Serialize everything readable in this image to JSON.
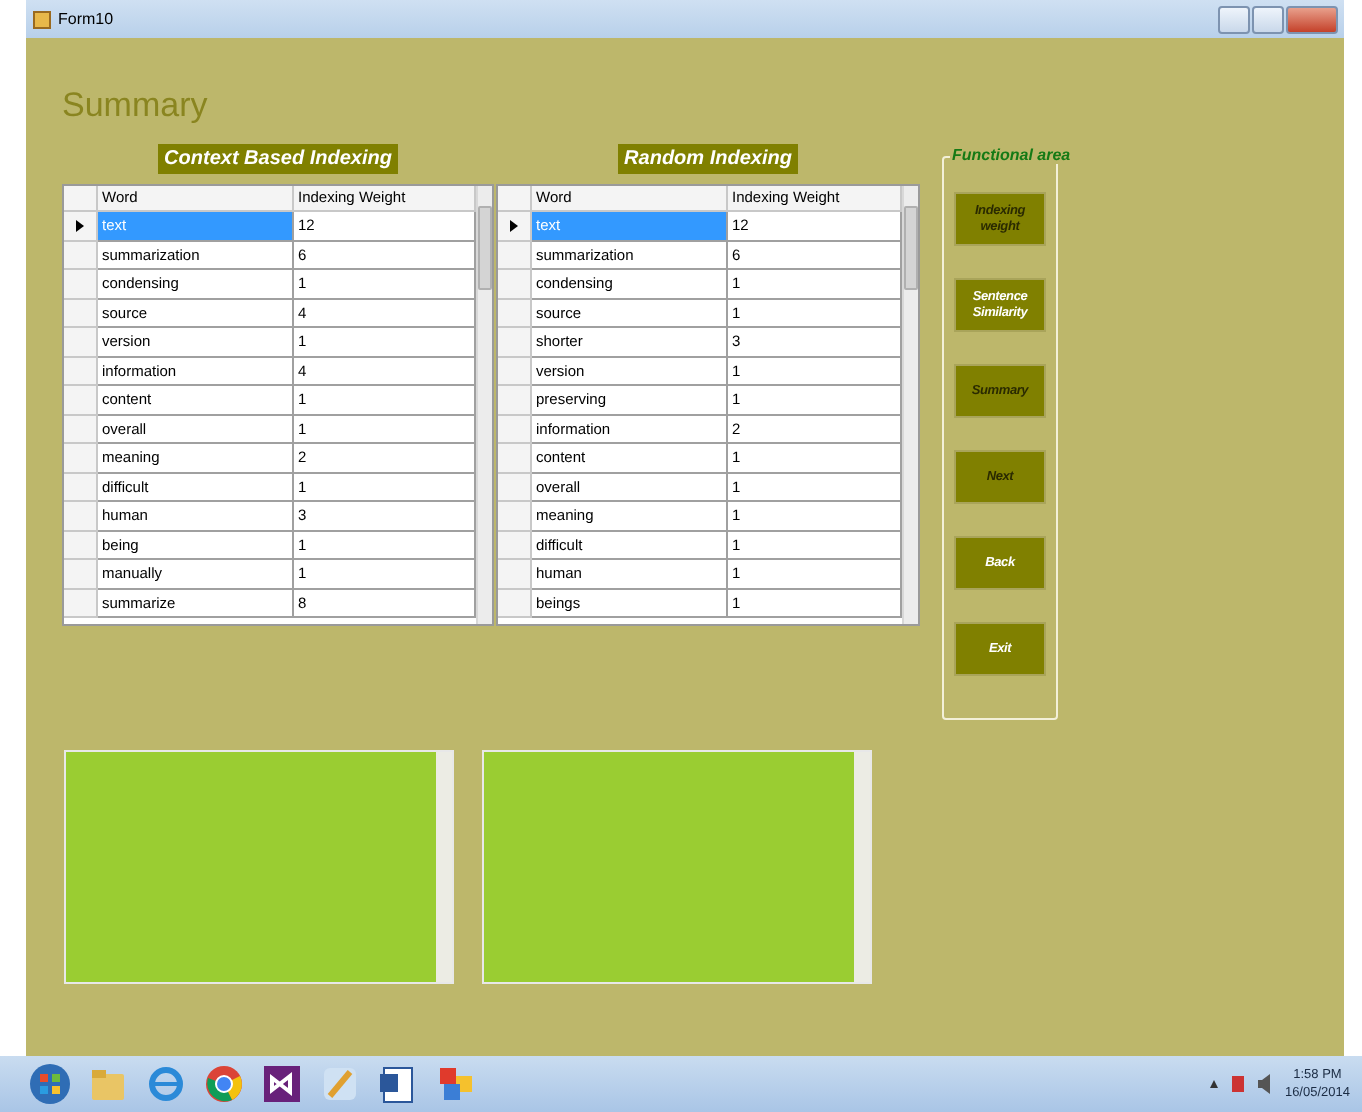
{
  "window": {
    "title": "Form10"
  },
  "heading": "Summary",
  "tables": [
    {
      "caption": "Context Based Indexing",
      "columns": [
        "Word",
        "Indexing Weight"
      ],
      "rows": [
        {
          "word": "text",
          "weight": "12",
          "selected": true
        },
        {
          "word": "summarization",
          "weight": "6",
          "selected": false
        },
        {
          "word": "condensing",
          "weight": "1",
          "selected": false
        },
        {
          "word": "source",
          "weight": "4",
          "selected": false
        },
        {
          "word": "version",
          "weight": "1",
          "selected": false
        },
        {
          "word": "information",
          "weight": "4",
          "selected": false
        },
        {
          "word": "content",
          "weight": "1",
          "selected": false
        },
        {
          "word": "overall",
          "weight": "1",
          "selected": false
        },
        {
          "word": "meaning",
          "weight": "2",
          "selected": false
        },
        {
          "word": "difficult",
          "weight": "1",
          "selected": false
        },
        {
          "word": "human",
          "weight": "3",
          "selected": false
        },
        {
          "word": "being",
          "weight": "1",
          "selected": false
        },
        {
          "word": "manually",
          "weight": "1",
          "selected": false
        },
        {
          "word": "summarize",
          "weight": "8",
          "selected": false
        }
      ]
    },
    {
      "caption": "Random Indexing",
      "columns": [
        "Word",
        "Indexing Weight"
      ],
      "rows": [
        {
          "word": "text",
          "weight": "12",
          "selected": true
        },
        {
          "word": "summarization",
          "weight": "6",
          "selected": false
        },
        {
          "word": "condensing",
          "weight": "1",
          "selected": false
        },
        {
          "word": "source",
          "weight": "1",
          "selected": false
        },
        {
          "word": "shorter",
          "weight": "3",
          "selected": false
        },
        {
          "word": "version",
          "weight": "1",
          "selected": false
        },
        {
          "word": "preserving",
          "weight": "1",
          "selected": false
        },
        {
          "word": "information",
          "weight": "2",
          "selected": false
        },
        {
          "word": "content",
          "weight": "1",
          "selected": false
        },
        {
          "word": "overall",
          "weight": "1",
          "selected": false
        },
        {
          "word": "meaning",
          "weight": "1",
          "selected": false
        },
        {
          "word": "difficult",
          "weight": "1",
          "selected": false
        },
        {
          "word": "human",
          "weight": "1",
          "selected": false
        },
        {
          "word": "beings",
          "weight": "1",
          "selected": false
        }
      ]
    }
  ],
  "functional_area": {
    "title": "Functional area",
    "buttons": [
      {
        "label": "Indexing weight",
        "kind": "dark"
      },
      {
        "label": "Sentence Similarity",
        "kind": "light"
      },
      {
        "label": "Summary",
        "kind": "dark"
      },
      {
        "label": "Next",
        "kind": "dark"
      },
      {
        "label": "Back",
        "kind": "light"
      },
      {
        "label": "Exit",
        "kind": "light"
      }
    ]
  },
  "clock": {
    "time": "1:58 PM",
    "date": "16/05/2014"
  }
}
